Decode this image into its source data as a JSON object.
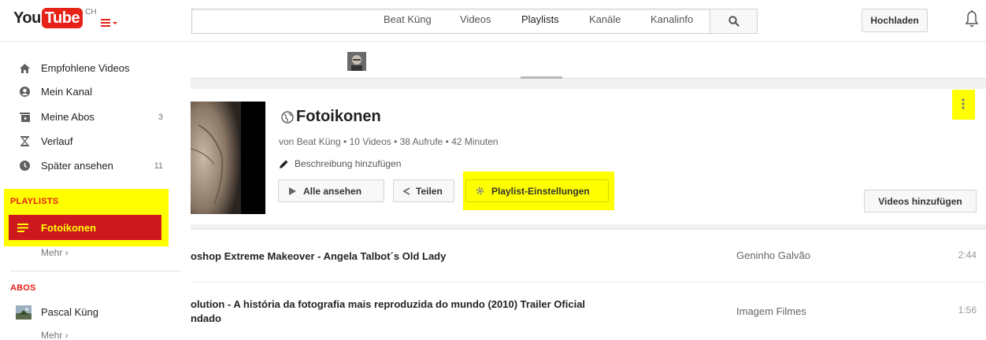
{
  "masthead": {
    "logo_you": "You",
    "logo_tube": "Tube",
    "region": "CH",
    "search_placeholder": "",
    "upload_label": "Hochladen"
  },
  "sidebar": {
    "items": [
      {
        "label": "Empfohlene Videos",
        "count": "",
        "icon": "home-icon"
      },
      {
        "label": "Mein Kanal",
        "count": "",
        "icon": "user-icon"
      },
      {
        "label": "Meine Abos",
        "count": "3",
        "icon": "subscriptions-icon"
      },
      {
        "label": "Verlauf",
        "count": "",
        "icon": "hourglass-icon"
      },
      {
        "label": "Später ansehen",
        "count": "11",
        "icon": "clock-icon"
      }
    ],
    "playlists_heading": "PLAYLISTS",
    "playlists": [
      {
        "label": "Fotoikonen",
        "selected": true
      }
    ],
    "playlists_more": "Mehr ›",
    "abos_heading": "ABOS",
    "abos": [
      {
        "label": "Pascal Küng"
      }
    ],
    "abos_more": "Mehr ›"
  },
  "channel_tabs": {
    "channel_name": "Beat Küng",
    "tabs": [
      "Videos",
      "Playlists",
      "Kanäle",
      "Kanalinfo"
    ],
    "active": "Playlists"
  },
  "playlist": {
    "title": "Fotoikonen",
    "meta": "von Beat Küng • 10 Videos • 38 Aufrufe • 42 Minuten",
    "add_description": "Beschreibung hinzufügen",
    "play_all": "Alle ansehen",
    "share": "Teilen",
    "settings": "Playlist-Einstellungen",
    "add_videos": "Videos hinzufügen",
    "more_menu": "⋮"
  },
  "videos": [
    {
      "title_line1": "oshop Extreme Makeover - Angela Talbot´s Old Lady",
      "title_line2": "",
      "owner": "Geninho Galvão",
      "duration": "2:44"
    },
    {
      "title_line1": "olution - A história da fotografia mais reproduzida do mundo (2010) Trailer Oficial",
      "title_line2": "ndado",
      "owner": "Imagem Filmes",
      "duration": "1:56"
    }
  ],
  "colors": {
    "brand_red": "#e62117",
    "selected_row": "#cc181e",
    "highlight": "#ffff00"
  }
}
